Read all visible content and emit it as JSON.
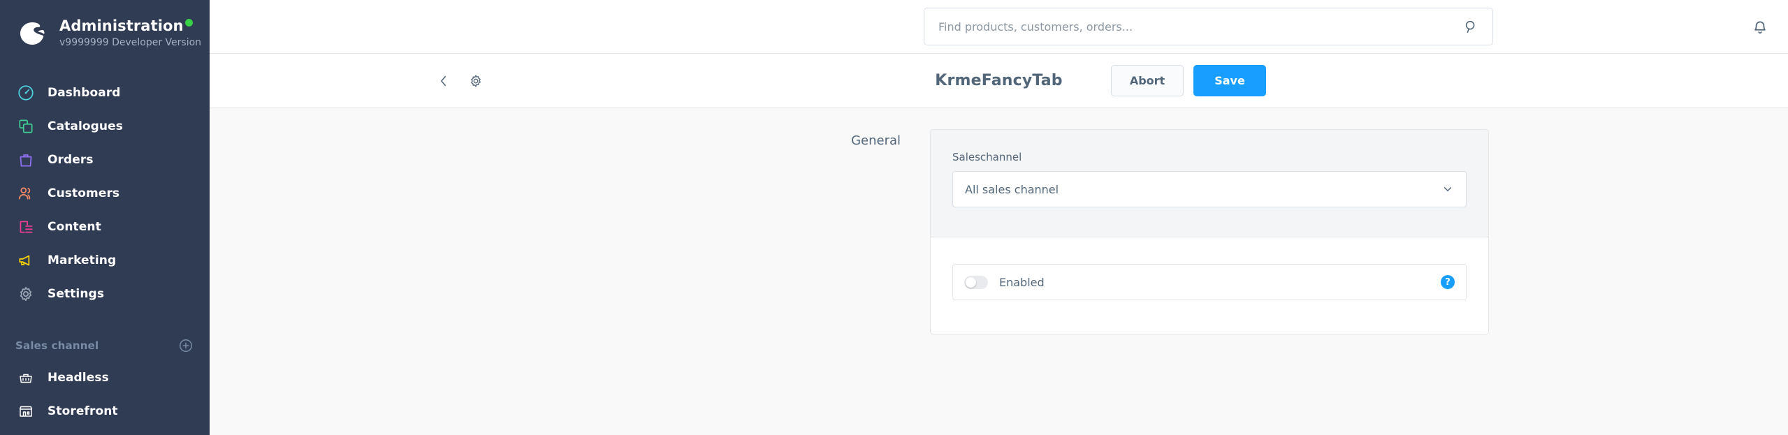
{
  "sidebar": {
    "brand": {
      "title": "Administration",
      "version": "v9999999 Developer Version",
      "logo_icon": "shopware-logo-icon",
      "status_dot_color": "#37d046"
    },
    "items": [
      {
        "label": "Dashboard",
        "icon": "dashboard-icon",
        "color": "#4dd2e0"
      },
      {
        "label": "Catalogues",
        "icon": "catalogues-icon",
        "color": "#3fcf92"
      },
      {
        "label": "Orders",
        "icon": "orders-icon",
        "color": "#9071f5"
      },
      {
        "label": "Customers",
        "icon": "customers-icon",
        "color": "#f88962"
      },
      {
        "label": "Content",
        "icon": "content-icon",
        "color": "#ec3f91"
      },
      {
        "label": "Marketing",
        "icon": "marketing-icon",
        "color": "#ffd700"
      },
      {
        "label": "Settings",
        "icon": "settings-gear-icon",
        "color": "#9aa5b5"
      }
    ],
    "sales_channel": {
      "title": "Sales channel",
      "add_icon": "plus-circle-icon",
      "items": [
        {
          "label": "Headless",
          "icon": "basket-icon"
        },
        {
          "label": "Storefront",
          "icon": "storefront-icon"
        }
      ]
    }
  },
  "topbar": {
    "search": {
      "placeholder": "Find products, customers, orders...",
      "value": "",
      "icon": "search-icon"
    },
    "notifications_icon": "bell-icon"
  },
  "smartbar": {
    "back_icon": "chevron-left-icon",
    "settings_icon": "gear-icon",
    "title": "KrmeFancyTab",
    "abort_label": "Abort",
    "save_label": "Save",
    "save_color": "#189eff"
  },
  "main": {
    "section_label": "General",
    "saleschannel": {
      "label": "Saleschannel",
      "value": "All sales channel",
      "chevron_icon": "chevron-down-icon"
    },
    "enabled": {
      "label": "Enabled",
      "state": "off",
      "help_icon": "question-mark-icon",
      "help_text": "?"
    }
  }
}
